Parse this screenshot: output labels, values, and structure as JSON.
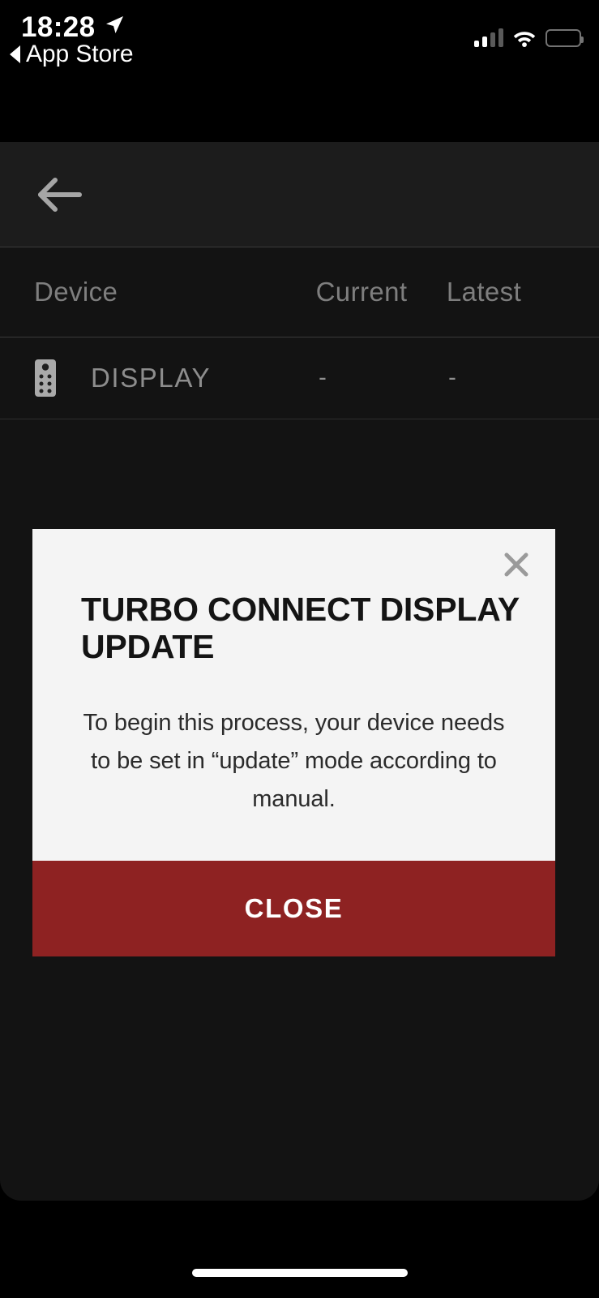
{
  "status_bar": {
    "time": "18:28",
    "location_icon": "location-arrow-icon",
    "return_arrow_icon": "back-triangle-icon",
    "return_label": "App Store",
    "signal_icon": "cellular-signal-icon",
    "wifi_icon": "wifi-icon",
    "battery_icon": "battery-icon"
  },
  "nav": {
    "back_icon": "arrow-left-icon"
  },
  "table": {
    "columns": [
      "Device",
      "Current",
      "Latest"
    ],
    "rows": [
      {
        "icon": "remote-control-icon",
        "device": "DISPLAY",
        "current": "-",
        "latest": "-"
      }
    ]
  },
  "modal": {
    "close_icon": "close-x-icon",
    "title": "TURBO CONNECT DISPLAY UPDATE",
    "body": "To begin this process, your device needs to be set in “update” mode according to manual.",
    "close_button_label": "CLOSE"
  },
  "home_indicator": "home-indicator-bar",
  "colors": {
    "screen_background": "#000000",
    "app_background": "#131313",
    "nav_background": "#1c1c1c",
    "divider": "#3a3a3a",
    "muted_text": "#7e7e7e",
    "modal_background": "#f4f4f4",
    "modal_title_text": "#141414",
    "accent_red": "#8e2222",
    "button_text": "#ffffff"
  }
}
